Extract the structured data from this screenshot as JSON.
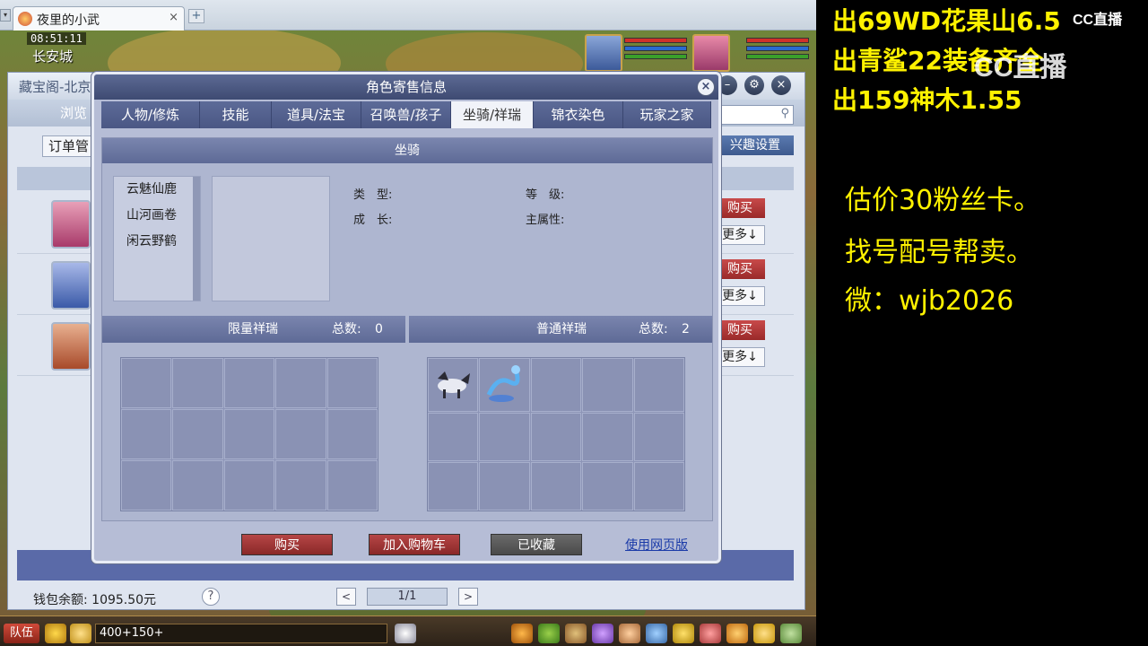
{
  "browser": {
    "tab_title": "夜里的小武",
    "tab_close": "×",
    "new_tab": "+",
    "tab_dropdown": "▾"
  },
  "game": {
    "time": "08:51:11",
    "location": "长安城"
  },
  "cbg": {
    "title": "藏宝阁-北京",
    "nav_browse": "浏览",
    "order_button": "订单管",
    "interest_button": "兴趣设置",
    "search_icon": "search-icon",
    "buy_label": "购买",
    "more_label": "更多↓",
    "wallet": "钱包余额: 1095.50元",
    "help": "?",
    "page": "1/1",
    "prev": "<",
    "next": ">"
  },
  "dialog": {
    "title": "角色寄售信息",
    "close": "×",
    "tabs": [
      "人物/修炼",
      "技能",
      "道具/法宝",
      "召唤兽/孩子",
      "坐骑/祥瑞",
      "锦衣染色",
      "玩家之家"
    ],
    "active_tab": "坐骑/祥瑞",
    "panel_title": "坐骑",
    "mounts": [
      "云魅仙鹿",
      "山河画卷",
      "闲云野鹤"
    ],
    "fields": {
      "type_label": "类　型:",
      "level_label": "等　级:",
      "growth_label": "成　长:",
      "main_attr_label": "主属性:"
    },
    "limited": {
      "label": "限量祥瑞",
      "total_label": "总数:",
      "total": "0"
    },
    "normal": {
      "label": "普通祥瑞",
      "total_label": "总数:",
      "total": "2"
    },
    "buttons": {
      "buy": "购买",
      "add_cart": "加入购物车",
      "favorited": "已收藏",
      "web_version": "使用网页版"
    }
  },
  "gamebar": {
    "team": "队伍",
    "chat_input": "400+150+"
  },
  "overlay": {
    "line1": "出69WD花果山6.5",
    "line2": "出青鲨22装备齐全",
    "line3": "出159神木1.55",
    "line4": "估价30粉丝卡。",
    "line5": "找号配号帮卖。",
    "line6": "微：wjb2026",
    "logo_small": "CC直播",
    "logo_big": "CC直播"
  },
  "colors": {
    "overlay_text": "#fff200",
    "dialog_header": "#3e4a72",
    "buy_red": "#9a2a2a"
  }
}
